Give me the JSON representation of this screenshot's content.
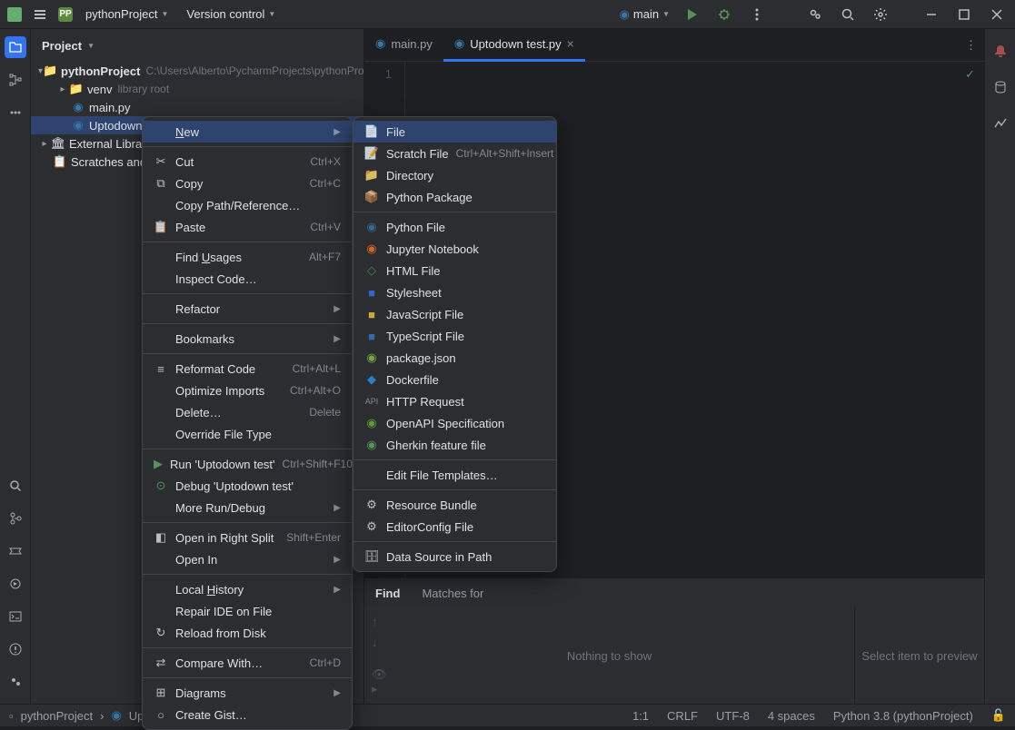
{
  "titlebar": {
    "project_name": "pythonProject",
    "version_control": "Version control",
    "run_config": "main"
  },
  "project": {
    "header": "Project",
    "root_name": "pythonProject",
    "root_path": "C:\\Users\\Alberto\\PycharmProjects\\pythonProject",
    "venv_name": "venv",
    "venv_hint": "library root",
    "file_main": "main.py",
    "file_uptodown": "Uptodown te",
    "ext_lib": "External Librarie",
    "scratches": "Scratches and C"
  },
  "tabs": {
    "main": "main.py",
    "uptodown": "Uptodown test.py"
  },
  "editor": {
    "line1": "1"
  },
  "find": {
    "title": "Find",
    "matches": "Matches for",
    "nothing": "Nothing to show",
    "preview": "Select item to preview"
  },
  "ctx": {
    "new": "New",
    "cut": "Cut",
    "cut_sc": "Ctrl+X",
    "copy": "Copy",
    "copy_sc": "Ctrl+C",
    "copy_path": "Copy Path/Reference…",
    "paste": "Paste",
    "paste_sc": "Ctrl+V",
    "find_usages": "Find Usages",
    "find_usages_sc": "Alt+F7",
    "inspect": "Inspect Code…",
    "refactor": "Refactor",
    "bookmarks": "Bookmarks",
    "reformat": "Reformat Code",
    "reformat_sc": "Ctrl+Alt+L",
    "optimize": "Optimize Imports",
    "optimize_sc": "Ctrl+Alt+O",
    "delete": "Delete…",
    "delete_sc": "Delete",
    "override": "Override File Type",
    "run": "Run 'Uptodown test'",
    "run_sc": "Ctrl+Shift+F10",
    "debug": "Debug 'Uptodown test'",
    "more_run": "More Run/Debug",
    "open_split": "Open in Right Split",
    "open_split_sc": "Shift+Enter",
    "open_in": "Open In",
    "local_history": "Local History",
    "repair": "Repair IDE on File",
    "reload": "Reload from Disk",
    "compare": "Compare With…",
    "compare_sc": "Ctrl+D",
    "diagrams": "Diagrams",
    "gist": "Create Gist…"
  },
  "submenu": {
    "file": "File",
    "scratch": "Scratch File",
    "scratch_sc": "Ctrl+Alt+Shift+Insert",
    "directory": "Directory",
    "py_pkg": "Python Package",
    "py_file": "Python File",
    "jupyter": "Jupyter Notebook",
    "html": "HTML File",
    "stylesheet": "Stylesheet",
    "js": "JavaScript File",
    "ts": "TypeScript File",
    "pkg_json": "package.json",
    "docker": "Dockerfile",
    "http": "HTTP Request",
    "openapi": "OpenAPI Specification",
    "gherkin": "Gherkin feature file",
    "templates": "Edit File Templates…",
    "bundle": "Resource Bundle",
    "editorconfig": "EditorConfig File",
    "datasource": "Data Source in Path"
  },
  "status": {
    "project": "pythonProject",
    "file": "Uptodown test.py",
    "pos": "1:1",
    "crlf": "CRLF",
    "enc": "UTF-8",
    "indent": "4 spaces",
    "interp": "Python 3.8 (pythonProject)"
  }
}
